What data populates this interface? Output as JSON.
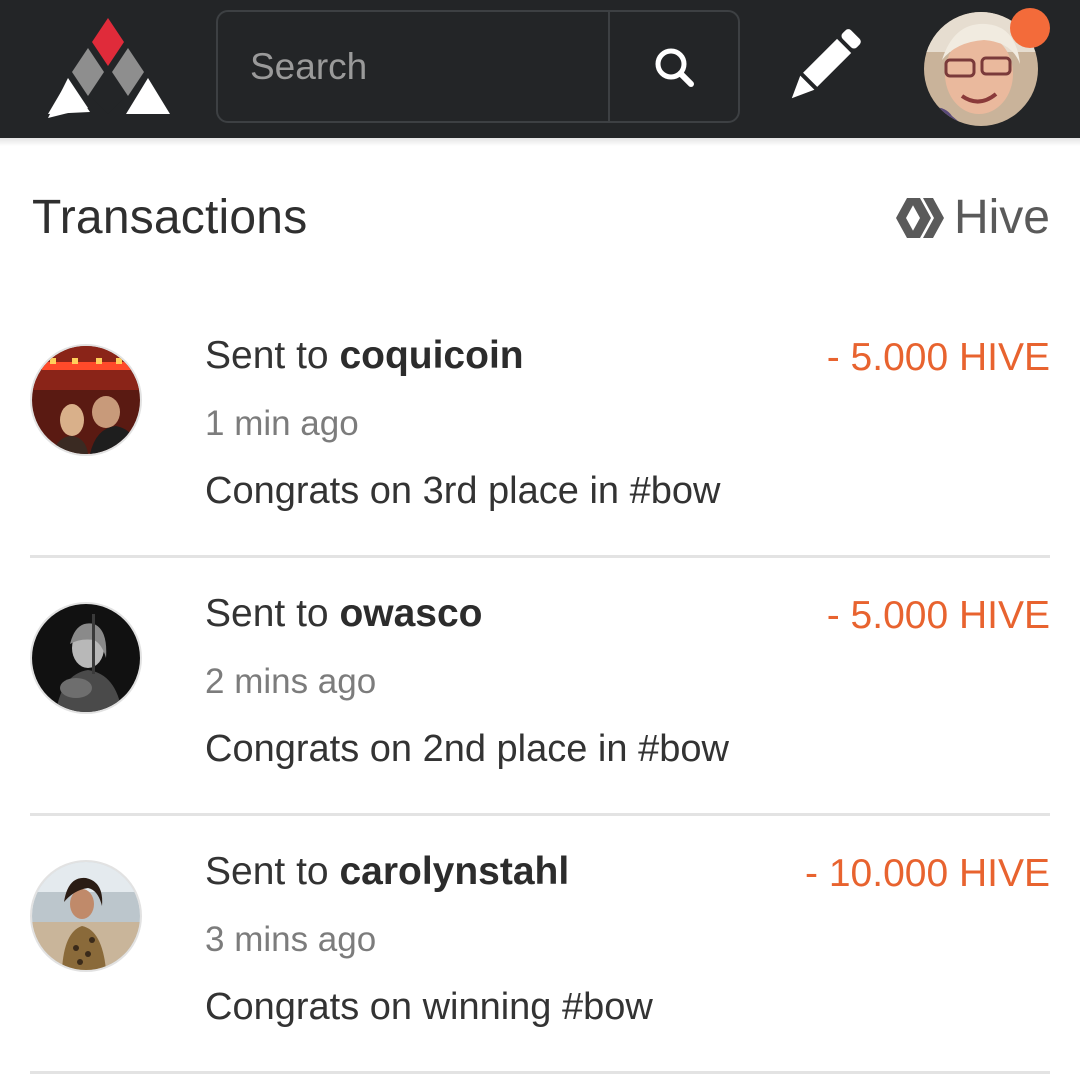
{
  "header": {
    "search_placeholder": "Search",
    "logo_icon": "ecency-logo-icon",
    "search_icon": "search-icon",
    "compose_icon": "pencil-icon",
    "has_notification": true
  },
  "page": {
    "title": "Transactions",
    "currency_label": "Hive"
  },
  "transactions": [
    {
      "prefix": "Sent to ",
      "user": "coquicoin",
      "time": "1 min ago",
      "memo": "Congrats on 3rd place in #bow",
      "amount": "- 5.000 HIVE"
    },
    {
      "prefix": "Sent to ",
      "user": "owasco",
      "time": "2 mins ago",
      "memo": "Congrats on 2nd place in #bow",
      "amount": "- 5.000 HIVE"
    },
    {
      "prefix": "Sent to ",
      "user": "carolynstahl",
      "time": "3 mins ago",
      "memo": "Congrats on winning #bow",
      "amount": "- 10.000 HIVE"
    }
  ],
  "colors": {
    "header_bg": "#232527",
    "accent_red": "#e02b3a",
    "amount_orange": "#e8632f",
    "notification": "#f36b3a"
  }
}
